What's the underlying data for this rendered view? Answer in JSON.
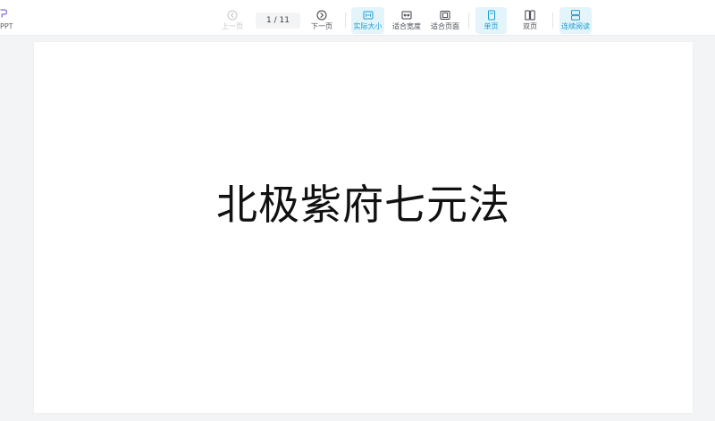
{
  "brand": {
    "label": "PPT",
    "icon": "ppt-logo-icon"
  },
  "toolbar": {
    "prev": {
      "label": "上一页",
      "icon": "arrow-left-circle-icon",
      "disabled": true
    },
    "page_indicator": {
      "current": "1",
      "total": "11",
      "text": "1 / 11"
    },
    "next": {
      "label": "下一页",
      "icon": "arrow-right-circle-icon"
    },
    "actual_size": {
      "label": "实际大小",
      "icon": "actual-size-icon",
      "active": true
    },
    "fit_width": {
      "label": "适合宽度",
      "icon": "fit-width-icon"
    },
    "fit_page": {
      "label": "适合页面",
      "icon": "fit-page-icon"
    },
    "single_page": {
      "label": "单页",
      "icon": "single-page-icon",
      "active": true
    },
    "double_page": {
      "label": "双页",
      "icon": "double-page-icon"
    },
    "continuous": {
      "label": "连续阅读",
      "icon": "continuous-read-icon",
      "active": true
    }
  },
  "slide": {
    "title": "北极紫府七元法"
  },
  "colors": {
    "accent": "#1a9bd1",
    "active_bg": "#e3f4fb",
    "toolbar_bg": "#ffffff",
    "canvas_bg": "#f3f4f6",
    "brand_purple": "#7b6fd6"
  }
}
